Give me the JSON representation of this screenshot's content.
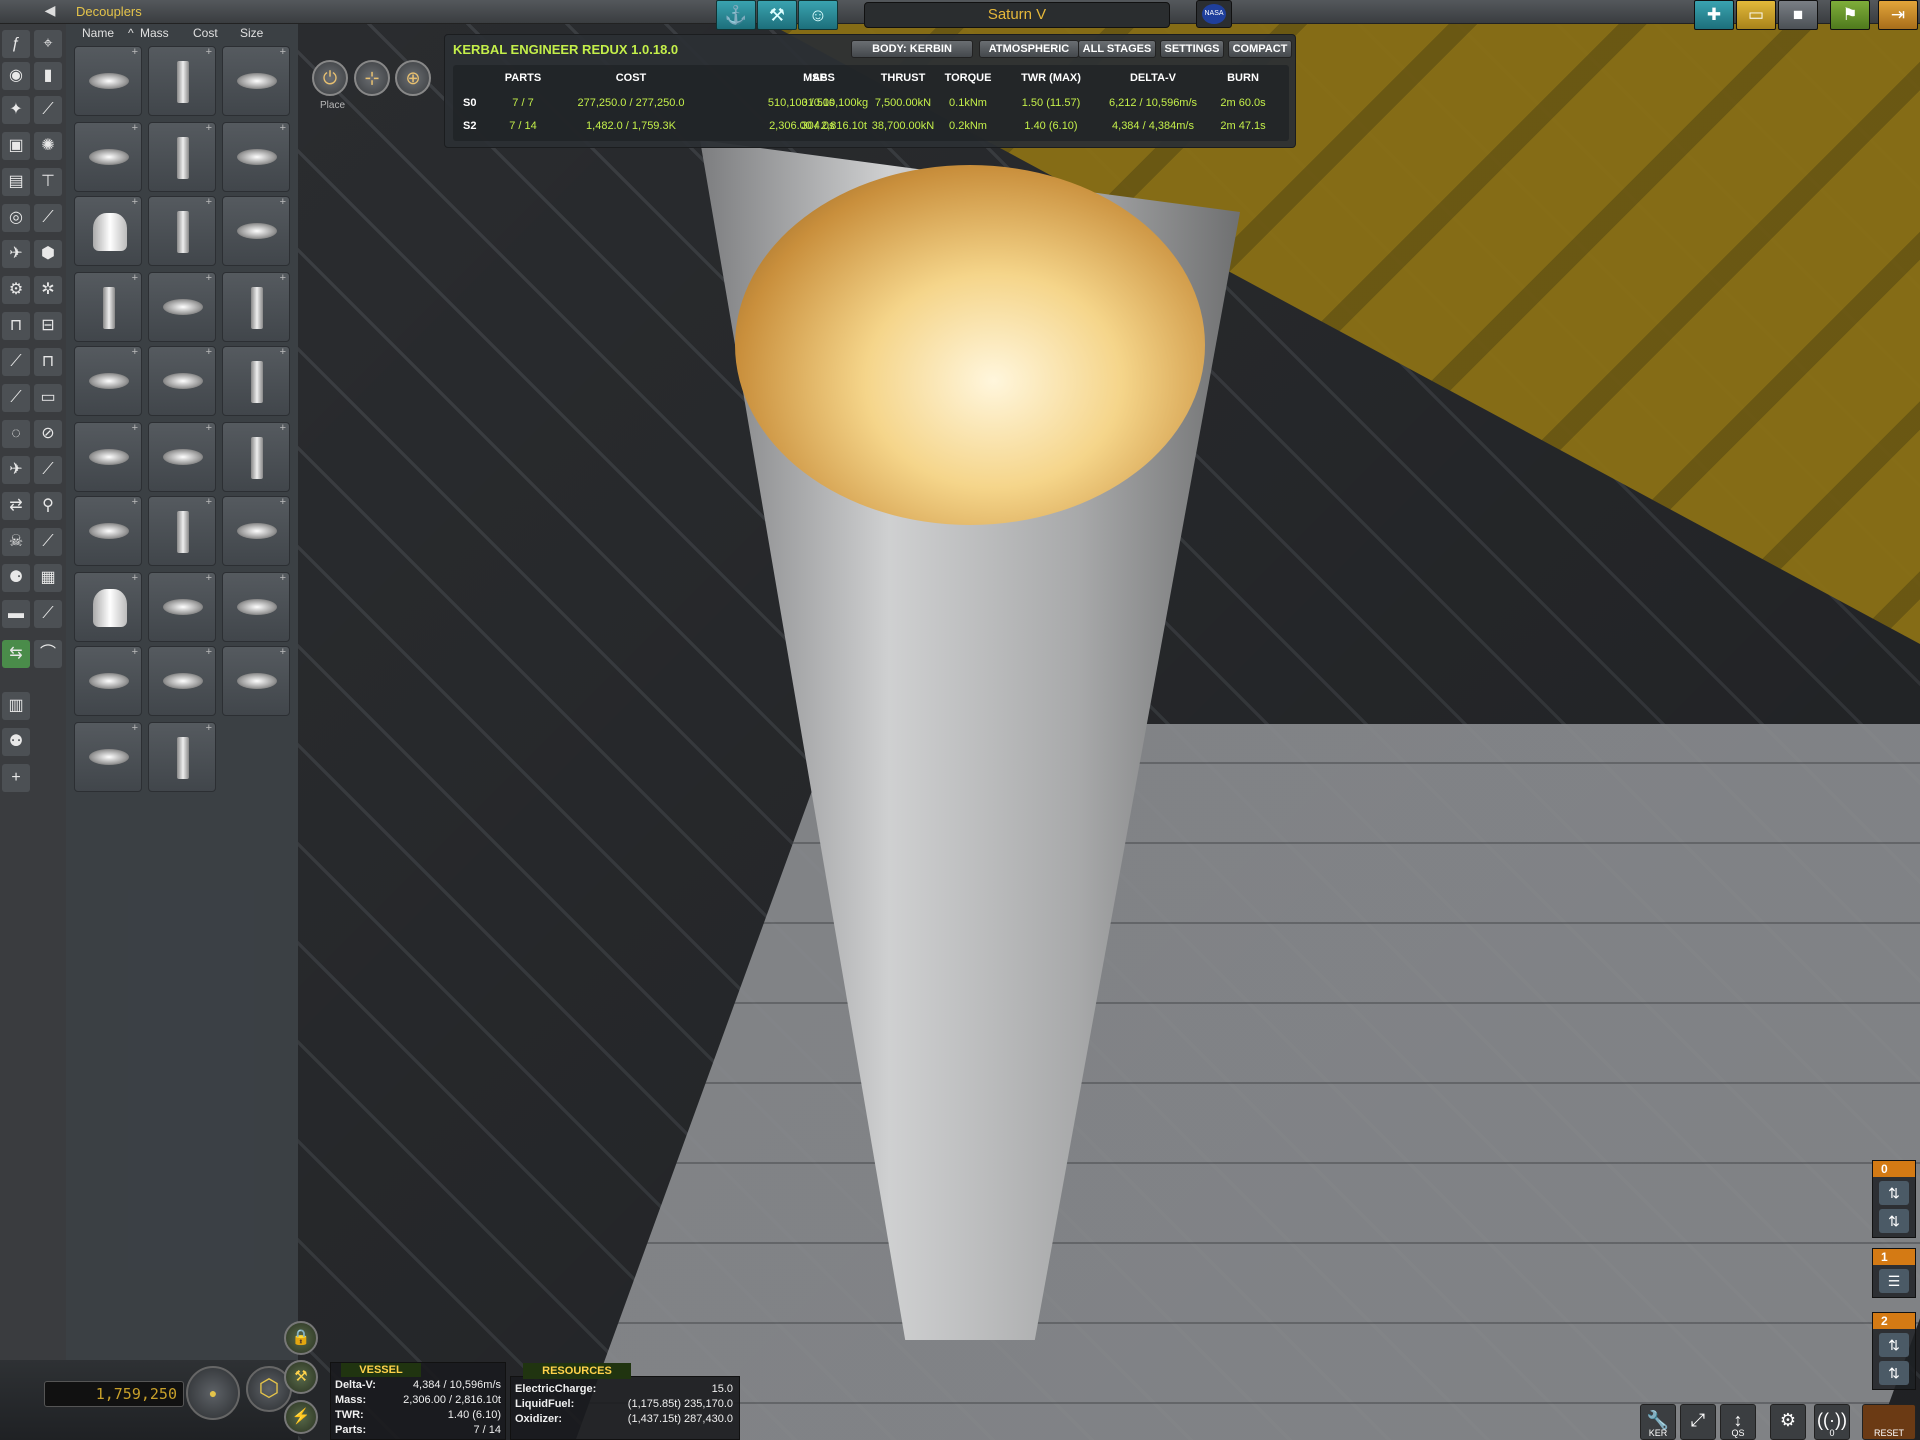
{
  "topbar": {
    "category_title": "Decouplers",
    "ship_name": "Saturn V",
    "flag_text": "NASA",
    "icons": [
      "sort-icon",
      "wrench-icon",
      "kerbal-crew-icon"
    ],
    "right_icons": [
      "new-craft-icon",
      "load-craft-icon",
      "save-craft-icon",
      "launch-pad-icon",
      "exit-icon"
    ]
  },
  "parts_panel": {
    "columns": [
      "Name",
      "Mass",
      "Cost",
      "Size"
    ],
    "sort_indicator": "^"
  },
  "editor_modes": {
    "place_label": "Place"
  },
  "ker": {
    "title": "KERBAL ENGINEER REDUX 1.0.18.0",
    "buttons": [
      "BODY: KERBIN",
      "ATMOSPHERIC",
      "ALL STAGES",
      "SETTINGS",
      "COMPACT"
    ],
    "headers": [
      "PARTS",
      "COST",
      "MASS",
      "ISP",
      "THRUST",
      "TORQUE",
      "TWR (MAX)",
      "DELTA-V",
      "BURN"
    ],
    "rows": [
      {
        "stage": "S0",
        "cells": [
          "7 / 7",
          "277,250.0 / 277,250.0",
          "510,100 / 510,100kg",
          "310.0s",
          "7,500.00kN",
          "0.1kNm",
          "1.50 (11.57)",
          "6,212 / 10,596m/s",
          "2m 60.0s"
        ]
      },
      {
        "stage": "S2",
        "cells": [
          "7 / 14",
          "1,482.0 / 1,759.3K",
          "2,306.00 / 2,816.10t",
          "304.0s",
          "38,700.00kN",
          "0.2kNm",
          "1.40 (6.10)",
          "4,384 / 4,384m/s",
          "2m 47.1s"
        ]
      }
    ]
  },
  "vessel": {
    "title": "VESSEL",
    "rows": [
      {
        "label": "Delta-V:",
        "value": "4,384 / 10,596m/s"
      },
      {
        "label": "Mass:",
        "value": "2,306.00 / 2,816.10t"
      },
      {
        "label": "TWR:",
        "value": "1.40 (6.10)"
      },
      {
        "label": "Parts:",
        "value": "7 / 14"
      }
    ]
  },
  "resources": {
    "title": "RESOURCES",
    "rows": [
      {
        "label": "ElectricCharge:",
        "value": "15.0"
      },
      {
        "label": "LiquidFuel:",
        "value": "(1,175.85t) 235,170.0"
      },
      {
        "label": "Oxidizer:",
        "value": "(1,437.15t) 287,430.0"
      }
    ]
  },
  "funds": "1,759,250",
  "staging": {
    "groups": [
      {
        "number": "0",
        "parts": [
          "decoupler-icon",
          "decoupler-icon"
        ]
      },
      {
        "number": "1",
        "parts": [
          "engine-icon"
        ]
      },
      {
        "number": "2",
        "parts": [
          "decoupler-icon",
          "decoupler-icon"
        ]
      }
    ]
  },
  "bottom_toolbar": {
    "ker_label": "KER",
    "qs_label": "QS",
    "comm_count": "0",
    "reset_label": "RESET"
  },
  "colors": {
    "ker_accent": "#c4ef4a",
    "ui_yellow": "#e4c34a",
    "stage_orange": "#d47a14"
  }
}
